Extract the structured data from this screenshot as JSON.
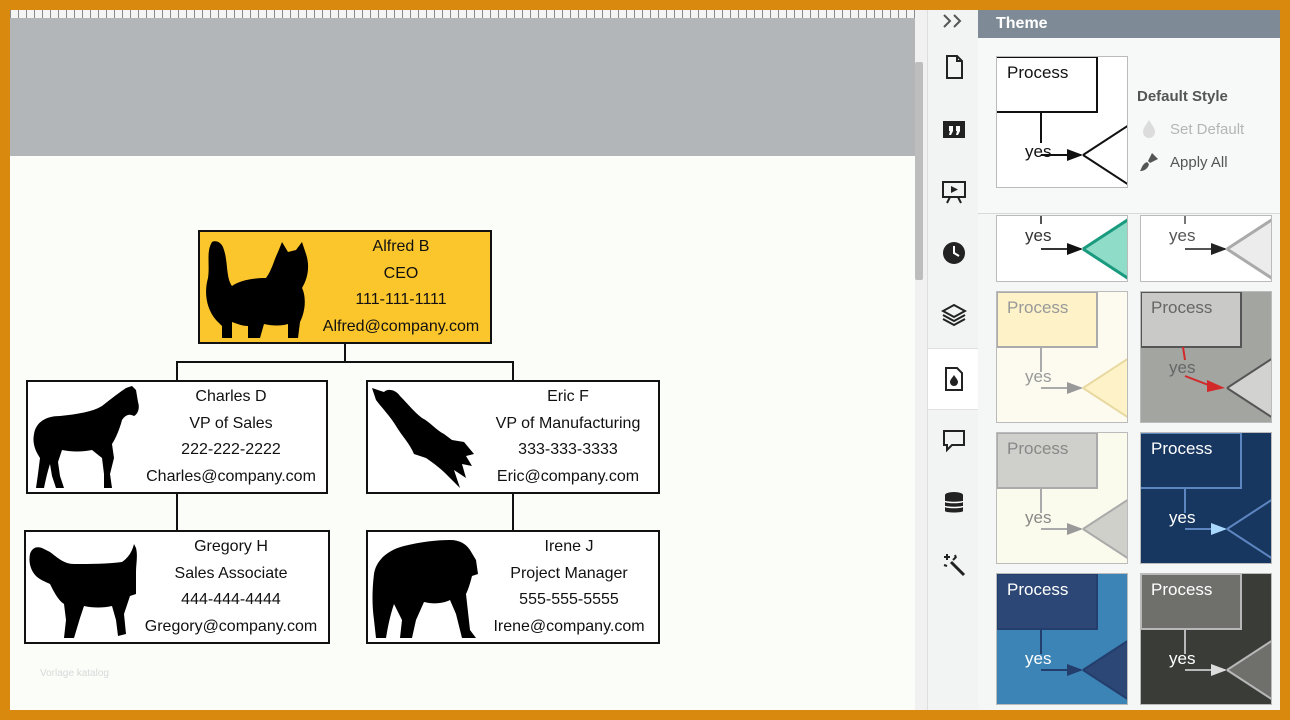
{
  "org_chart": {
    "ceo": {
      "name": "Alfred B",
      "title": "CEO",
      "phone": "111-111-1111",
      "email": "Alfred@company.com",
      "picture": "cat-silhouette"
    },
    "charles": {
      "name": "Charles D",
      "title": "VP of Sales",
      "phone": "222-222-2222",
      "email": "Charles@company.com",
      "picture": "horse-silhouette"
    },
    "eric": {
      "name": "Eric F",
      "title": "VP of Manufacturing",
      "phone": "333-333-3333",
      "email": "Eric@company.com",
      "picture": "eagle-silhouette"
    },
    "gregory": {
      "name": "Gregory H",
      "title": "Sales Associate",
      "phone": "444-444-4444",
      "email": "Gregory@company.com",
      "picture": "dog-silhouette"
    },
    "irene": {
      "name": "Irene J",
      "title": "Project Manager",
      "phone": "555-555-5555",
      "email": "Irene@company.com",
      "picture": "bear-silhouette"
    }
  },
  "watermark": "Vorlage katalog",
  "rail": {
    "icons": [
      "collapse-icon",
      "page-icon",
      "quote-icon",
      "presentation-icon",
      "history-icon",
      "layers-icon",
      "theme-icon",
      "comment-icon",
      "data-icon",
      "magic-icon"
    ],
    "active": "theme-icon"
  },
  "panel": {
    "title": "Theme",
    "default_style_label": "Default Style",
    "set_default": "Set Default",
    "apply_all": "Apply All",
    "sample_process": "Process",
    "sample_yes": "yes"
  },
  "themes": [
    {
      "id": "default",
      "bg": "#ffffff",
      "line": "#111111",
      "text": "#111111",
      "fill": "#ffffff",
      "accent": "#111111"
    },
    {
      "id": "teal",
      "bg": "#ffffff",
      "line": "#555555",
      "text": "#333333",
      "fill": "#8fdcc8",
      "accent": "#1a9a7e"
    },
    {
      "id": "light-gray",
      "bg": "#ffffff",
      "line": "#777777",
      "text": "#555555",
      "fill": "#ececec",
      "accent": "#aaaaaa"
    },
    {
      "id": "cream",
      "bg": "#fdfbf0",
      "line": "#aaaaaa",
      "text": "#999999",
      "fill": "#fdf2c8",
      "accent": "#e8d9a0"
    },
    {
      "id": "gray-red",
      "bg": "#a3a5a1",
      "line": "#555555",
      "text": "#666666",
      "fill": "#c9cac7",
      "accent": "#d22a2a"
    },
    {
      "id": "pale",
      "bg": "#fbfbed",
      "line": "#9a9a9a",
      "text": "#888888",
      "fill": "#cfd0cb",
      "accent": "#aaaaaa"
    },
    {
      "id": "navy",
      "bg": "#173660",
      "line": "#5d86c0",
      "text": "#ffffff",
      "fill": "#173660",
      "accent": "#a9d8ff"
    },
    {
      "id": "blue",
      "bg": "#3b84b5",
      "line": "#233e6c",
      "text": "#ffffff",
      "fill": "#2c4775",
      "accent": "#233e6c"
    },
    {
      "id": "charcoal",
      "bg": "#3a3c37",
      "line": "#b8b8b8",
      "text": "#ffffff",
      "fill": "#6f706c",
      "accent": "#dddddd"
    }
  ]
}
